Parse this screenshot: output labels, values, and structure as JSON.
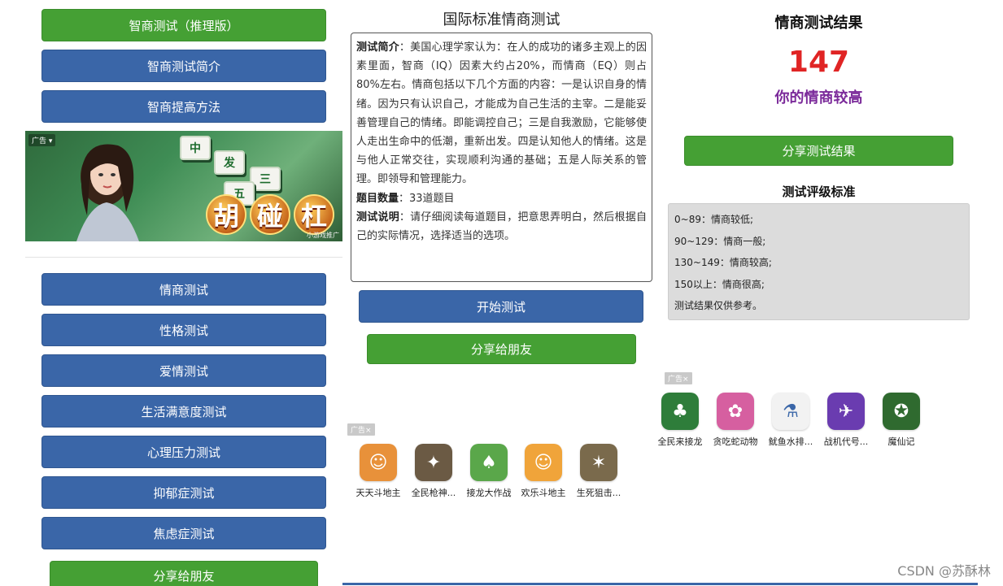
{
  "panel1": {
    "buttons_top": [
      {
        "label": "智商测试（推理版）",
        "color": "#45a034"
      },
      {
        "label": "智商测试简介",
        "color": "#3a66a8"
      },
      {
        "label": "智商提高方法",
        "color": "#3a66a8"
      }
    ],
    "banner": {
      "ad_tag": "广告 ▾",
      "tiles": [
        "中",
        "发",
        "三",
        "五"
      ],
      "words": [
        "胡",
        "碰",
        "杠"
      ],
      "source": "小游戏推广"
    },
    "buttons_bottom": [
      {
        "label": "情商测试"
      },
      {
        "label": "性格测试"
      },
      {
        "label": "爱情测试"
      },
      {
        "label": "生活满意度测试"
      },
      {
        "label": "心理压力测试"
      },
      {
        "label": "抑郁症测试"
      },
      {
        "label": "焦虑症测试"
      }
    ],
    "share_label": "分享给朋友"
  },
  "panel2": {
    "title": "国际标准情商测试",
    "intro_label": "测试简介",
    "intro_text": "：美国心理学家认为：在人的成功的诸多主观上的因素里面，智商（IQ）因素大约占20%，而情商（EQ）则占80%左右。情商包括以下几个方面的内容：一是认识自身的情绪。因为只有认识自己，才能成为自己生活的主宰。二是能妥善管理自己的情绪。即能调控自己；三是自我激励，它能够使人走出生命中的低潮，重新出发。四是认知他人的情绪。这是与他人正常交往，实现顺利沟通的基础；五是人际关系的管理。即领导和管理能力。",
    "count_label": "题目数量",
    "count_text": "：33道题目",
    "note_label": "测试说明",
    "note_text": "：请仔细阅读每道题目，把意思弄明白，然后根据自己的实际情况，选择适当的选项。",
    "start_label": "开始测试",
    "share_label": "分享给朋友",
    "ad_tag": "广告×",
    "apps": [
      {
        "label": "天天斗地主",
        "color": "#e8913a",
        "glyph": "☺"
      },
      {
        "label": "全民枪神...",
        "color": "#6b5a44",
        "glyph": "✦"
      },
      {
        "label": "接龙大作战",
        "color": "#5aa74a",
        "glyph": "♠"
      },
      {
        "label": "欢乐斗地主",
        "color": "#f0a43a",
        "glyph": "☺"
      },
      {
        "label": "生死狙击...",
        "color": "#7a6a4c",
        "glyph": "✶"
      }
    ]
  },
  "panel3": {
    "title": "情商测试结果",
    "score": "147",
    "score_desc": "你的情商较高",
    "share_label": "分享测试结果",
    "std_title": "测试评级标准",
    "std_lines": [
      "0~89：情商较低;",
      "90~129：情商一般;",
      "130~149：情商较高;",
      "150以上：情商很高;",
      "测试结果仅供参考。"
    ],
    "ad_tag": "广告×",
    "apps": [
      {
        "label": "全民来接龙",
        "color": "#2e7d3a",
        "glyph": "♣"
      },
      {
        "label": "贪吃蛇动物",
        "color": "#d65fa0",
        "glyph": "✿"
      },
      {
        "label": "鱿鱼水排...",
        "color": "#f2f2f2",
        "glyph": "⚗"
      },
      {
        "label": "战机代号...",
        "color": "#6a3cb0",
        "glyph": "✈"
      },
      {
        "label": "魔仙记",
        "color": "#2f6a2f",
        "glyph": "✪"
      }
    ]
  },
  "watermark": "CSDN @苏酥林"
}
